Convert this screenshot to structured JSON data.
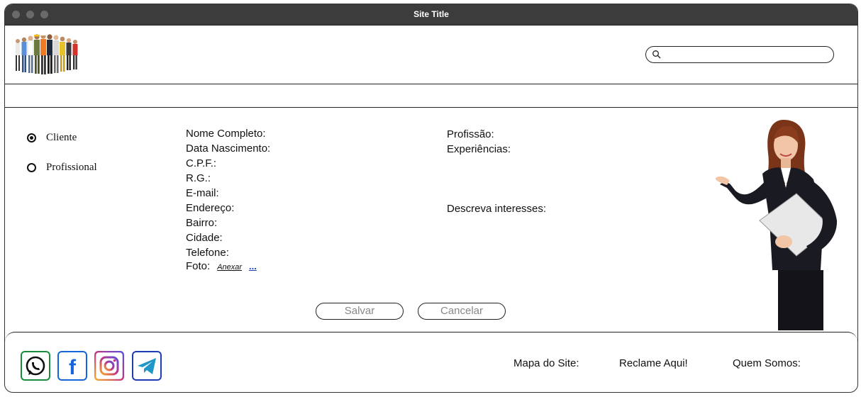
{
  "window": {
    "title": "Site Title"
  },
  "search": {
    "placeholder": "",
    "value": ""
  },
  "account_type": {
    "options": [
      {
        "label": "Cliente",
        "selected": true
      },
      {
        "label": "Profissional",
        "selected": false
      }
    ]
  },
  "form": {
    "left_fields": [
      "Nome Completo:",
      "Data Nascimento:",
      "C.P.F.:",
      "R.G.:",
      "E-mail:",
      "Endereço:",
      "Bairro:",
      "Cidade:",
      "Telefone:"
    ],
    "foto_label": "Foto:",
    "attach_label": "Anexar",
    "attach_more": "...",
    "profissao_label": "Profissão:",
    "experiencias_label": "Experiências:",
    "interesses_label": "Descreva interesses:"
  },
  "buttons": {
    "save": "Salvar",
    "cancel": "Cancelar"
  },
  "footer": {
    "social_icons": [
      "whatsapp-icon",
      "facebook-icon",
      "instagram-icon",
      "telegram-icon"
    ],
    "links": [
      "Mapa do Site:",
      "Reclame Aqui!",
      "Quem Somos:"
    ]
  },
  "colors": {
    "titlebar": "#3c3c3c",
    "whatsapp": "#1a8a3c",
    "facebook": "#1565d8",
    "instagram": "#c13584",
    "telegram": "#1f98c9"
  }
}
